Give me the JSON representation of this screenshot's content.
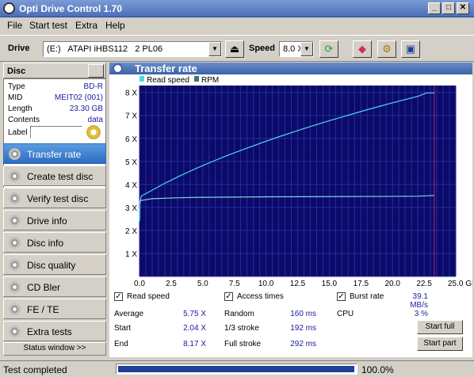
{
  "window": {
    "title": "Opti Drive Control 1.70"
  },
  "menu": [
    "File",
    "Start test",
    "Extra",
    "Help"
  ],
  "toolbar": {
    "drive_label": "Drive",
    "drive_value": "(E:)   ATAPI iHBS112   2 PL06",
    "speed_label": "Speed",
    "speed_value": "8.0 X"
  },
  "disc": {
    "header": "Disc",
    "fields": [
      {
        "key": "Type",
        "value": "BD-R"
      },
      {
        "key": "MID",
        "value": "MEIT02 (001)"
      },
      {
        "key": "Length",
        "value": "23.30 GB"
      },
      {
        "key": "Contents",
        "value": "data"
      }
    ],
    "label_key": "Label"
  },
  "nav": [
    "Transfer rate",
    "Create test disc",
    "Verify test disc",
    "Drive info",
    "Disc info",
    "Disc quality",
    "CD Bler",
    "FE / TE",
    "Extra tests"
  ],
  "nav_active_index": 0,
  "status_window_label": "Status window >>",
  "panel_title": "Transfer rate",
  "chart_data": {
    "type": "line",
    "legend": [
      "Read speed",
      "RPM"
    ],
    "x_ticks": [
      "0.0",
      "2.5",
      "5.0",
      "7.5",
      "10.0",
      "12.5",
      "15.0",
      "17.5",
      "20.0",
      "22.5",
      "25.0 GB"
    ],
    "y_ticks": [
      "1 X",
      "2 X",
      "3 X",
      "4 X",
      "5 X",
      "6 X",
      "7 X",
      "8 X"
    ],
    "xlim": [
      0,
      25
    ],
    "ylim": [
      0,
      8.3
    ],
    "series": [
      {
        "name": "Read speed",
        "color": "#4cd8ea",
        "x": [
          0.0,
          0.05,
          0.15,
          1,
          2,
          3,
          4,
          5,
          6,
          7,
          8,
          9,
          10,
          11,
          12,
          13,
          14,
          15,
          16,
          17,
          18,
          19,
          20,
          21,
          22,
          22.7,
          23.3
        ],
        "y": [
          2.4,
          3.3,
          3.5,
          3.75,
          4.05,
          4.32,
          4.58,
          4.82,
          5.05,
          5.27,
          5.48,
          5.68,
          5.88,
          6.07,
          6.25,
          6.43,
          6.6,
          6.77,
          6.93,
          7.09,
          7.25,
          7.4,
          7.55,
          7.69,
          7.83,
          7.98,
          7.98
        ]
      },
      {
        "name": "RPM",
        "color": "#7fd7d7",
        "x": [
          0.0,
          0.1,
          1,
          3,
          5,
          10,
          15,
          20,
          22,
          23.3
        ],
        "y": [
          3.2,
          3.3,
          3.38,
          3.42,
          3.44,
          3.46,
          3.47,
          3.48,
          3.49,
          3.52
        ]
      }
    ],
    "marker_x": 23.3
  },
  "stats": {
    "read_speed_label": "Read speed",
    "access_times_label": "Access times",
    "burst_rate_label": "Burst rate",
    "burst_rate_value": "39.1 MB/s",
    "average_label": "Average",
    "average_value": "5.75 X",
    "start_label": "Start",
    "start_value": "2.04 X",
    "end_label": "End",
    "end_value": "8.17 X",
    "random_label": "Random",
    "random_value": "160 ms",
    "stroke13_label": "1/3 stroke",
    "stroke13_value": "192 ms",
    "fullstroke_label": "Full stroke",
    "fullstroke_value": "292 ms",
    "cpu_label": "CPU",
    "cpu_value": "3 %",
    "start_full_button": "Start full",
    "start_part_button": "Start part"
  },
  "statusbar": {
    "text": "Test completed",
    "progress": 1.0,
    "percent": "100.0%"
  }
}
